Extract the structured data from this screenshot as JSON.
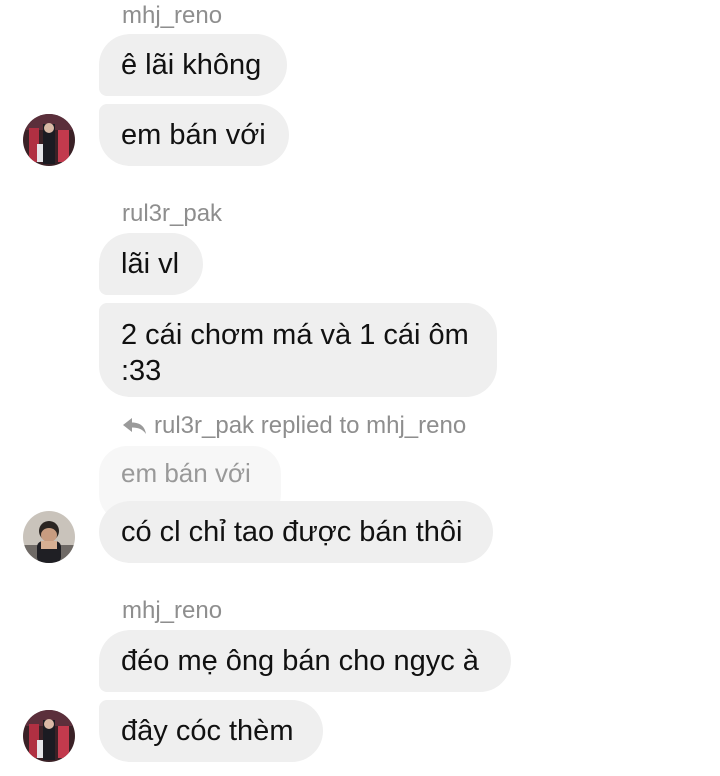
{
  "messages": {
    "group1": {
      "sender": "mhj_reno",
      "bubbles": [
        "ê lãi không",
        "em bán với"
      ]
    },
    "group2": {
      "sender": "rul3r_pak",
      "bubbles": [
        "lãi vl",
        "2 cái chơm má và 1 cái ôm :33"
      ],
      "bubble2_lines": [
        "2 cái chơm má và 1 cái ôm",
        ":33"
      ]
    },
    "reply": {
      "label": "rul3r_pak replied to mhj_reno",
      "quoted": "em bán với",
      "text": "có cl chỉ tao được bán thôi"
    },
    "group3": {
      "sender": "mhj_reno",
      "bubbles": [
        "đéo mẹ ông bán cho ngyc à",
        "đây cóc thèm"
      ]
    }
  },
  "colors": {
    "bubble_bg": "#efefef",
    "quoted_bg": "#f7f7f7",
    "sender_text": "#8e8e8e",
    "message_text": "#111111"
  },
  "icons": {
    "reply": "reply-arrow-icon",
    "avatar": "avatar"
  }
}
